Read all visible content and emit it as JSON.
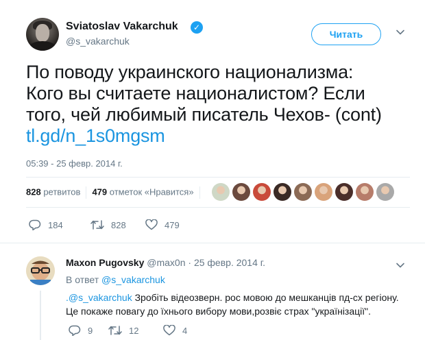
{
  "tweet": {
    "display_name": "Sviatoslav Vakarchuk",
    "verified_icon": "verified-badge-icon",
    "handle": "@s_vakarchuk",
    "follow_label": "Читать",
    "text_lines": [
      "По поводу украинского национализма:",
      "Кого вы считаете националистом? Если",
      "того, чей любимый писатель Чехов- (cont)"
    ],
    "link": "tl.gd/n_1s0mgsm",
    "timestamp": "05:39 - 25 февр. 2014 г.",
    "stats": {
      "retweets_count": "828",
      "retweets_label": "ретвитов",
      "likes_count": "479",
      "likes_label": "отметок «Нравится»"
    },
    "liker_avatars": [
      "#cfd8c6",
      "#6b4a3e",
      "#c94a3a",
      "#3a2a25",
      "#8b6a55",
      "#d9a37a",
      "#4a2e2a",
      "#b77c6a",
      "#a9a9a9"
    ],
    "actions": {
      "replies": "184",
      "retweets": "828",
      "likes": "479"
    }
  },
  "reply": {
    "name": "Maxon Pugovsky",
    "handle": "@max0n",
    "sep": " · ",
    "date": "25 февр. 2014 г.",
    "in_reply_prefix": "В ответ ",
    "in_reply_handle": "@s_vakarchuk",
    "mention": ".@s_vakarchuk",
    "text_line1_rest": " Зробіть відеозверн. рос мовою до мешканців пд-сх регіону.",
    "text_line2": "Це покаже повагу до їхнього вибору мови,розвіє страх \"українізації\".",
    "actions": {
      "replies": "9",
      "retweets": "12",
      "likes": "4"
    }
  },
  "colors": {
    "accent": "#1da1f2",
    "link": "#1b95e0",
    "muted": "#657786",
    "divider": "#e6ecf0"
  }
}
